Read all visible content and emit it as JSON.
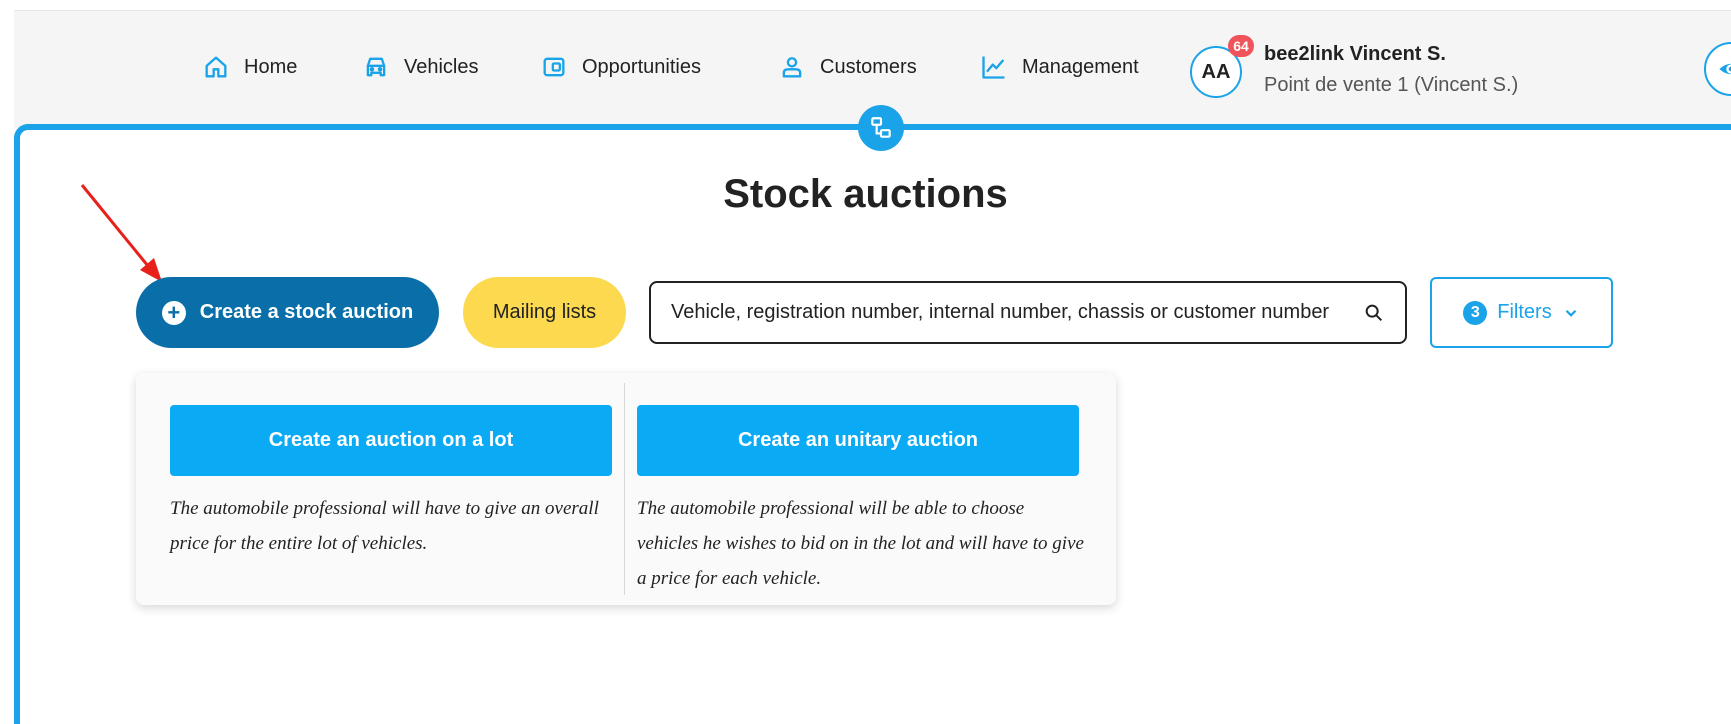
{
  "nav": {
    "items": [
      {
        "label": "Home",
        "icon": "home-icon"
      },
      {
        "label": "Vehicles",
        "icon": "car-icon"
      },
      {
        "label": "Opportunities",
        "icon": "wallet-icon"
      },
      {
        "label": "Customers",
        "icon": "person-icon"
      },
      {
        "label": "Management",
        "icon": "chart-line-icon"
      }
    ]
  },
  "user": {
    "initials": "AA",
    "notification_count": "64",
    "name": "bee2link Vincent S.",
    "store": "Point de vente 1 (Vincent S.)"
  },
  "page": {
    "title": "Stock auctions"
  },
  "toolbar": {
    "create_label": "Create a stock auction",
    "mailing_label": "Mailing lists",
    "search_placeholder": "Vehicle, registration number, internal number, chassis or customer number",
    "filters_count": "3",
    "filters_label": "Filters"
  },
  "dropdown": {
    "lot": {
      "button": "Create an auction on a lot",
      "description": "The automobile professional will have to give an overall price for the entire lot of vehicles."
    },
    "unitary": {
      "button": "Create an unitary auction",
      "description": "The automobile professional will be able to choose vehicles he wishes to bid on in the lot and will have to give a price for each vehicle."
    }
  },
  "colors": {
    "accent": "#1aa3e8",
    "primary_dark": "#0a6fa8",
    "yellow": "#fdd94f",
    "option_button": "#0aaaf5",
    "badge": "#f0535a",
    "annotation_arrow": "#e8201a"
  }
}
